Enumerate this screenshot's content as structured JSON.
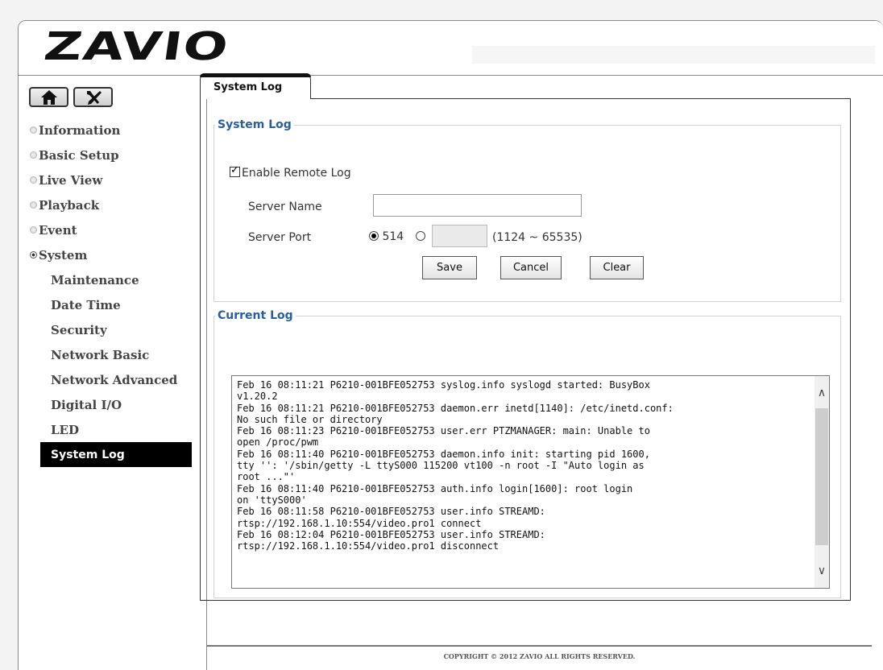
{
  "header": {
    "logo": "ZAVIO"
  },
  "nav": {
    "items": [
      {
        "label": "Information",
        "expanded": false
      },
      {
        "label": "Basic Setup",
        "expanded": false
      },
      {
        "label": "Live View",
        "expanded": false
      },
      {
        "label": "Playback",
        "expanded": false
      },
      {
        "label": "Event",
        "expanded": false
      },
      {
        "label": "System",
        "expanded": true
      }
    ],
    "sub_items": [
      "Maintenance",
      "Date Time",
      "Security",
      "Network Basic",
      "Network Advanced",
      "Digital I/O",
      "LED",
      "System Log"
    ],
    "active_sub": "System Log"
  },
  "tab": {
    "label": "System Log"
  },
  "system_log": {
    "legend": "System Log",
    "enable_label": "Enable Remote Log",
    "enable_checked": true,
    "server_name_label": "Server Name",
    "server_name_value": "",
    "server_port_label": "Server Port",
    "port_default": "514",
    "port_custom_value": "",
    "port_range": "(1124 ~ 65535)",
    "save_label": "Save",
    "cancel_label": "Cancel",
    "clear_label": "Clear"
  },
  "current_log": {
    "legend": "Current Log",
    "lines": [
      "Feb 16 08:11:21 P6210-001BFE052753 syslog.info syslogd started: BusyBox",
      "v1.20.2",
      "Feb 16 08:11:21 P6210-001BFE052753 daemon.err inetd[1140]: /etc/inetd.conf:",
      "No such file or directory",
      "Feb 16 08:11:23 P6210-001BFE052753 user.err PTZMANAGER: main: Unable to",
      "open /proc/pwm",
      "Feb 16 08:11:40 P6210-001BFE052753 daemon.info init: starting pid 1600,",
      "tty '': '/sbin/getty -L ttyS000 115200 vt100 -n root -I \"Auto login as",
      "root ...\"'",
      "Feb 16 08:11:40 P6210-001BFE052753 auth.info login[1600]: root login",
      "on 'ttyS000'",
      "Feb 16 08:11:58 P6210-001BFE052753 user.info STREAMD:",
      "rtsp://192.168.1.10:554/video.pro1 connect",
      "Feb 16 08:12:04 P6210-001BFE052753 user.info STREAMD:",
      "rtsp://192.168.1.10:554/video.pro1 disconnect"
    ]
  },
  "footer": {
    "copyright": "COPYRIGHT © 2012 ZAVIO ALL RIGHTS RESERVED."
  }
}
